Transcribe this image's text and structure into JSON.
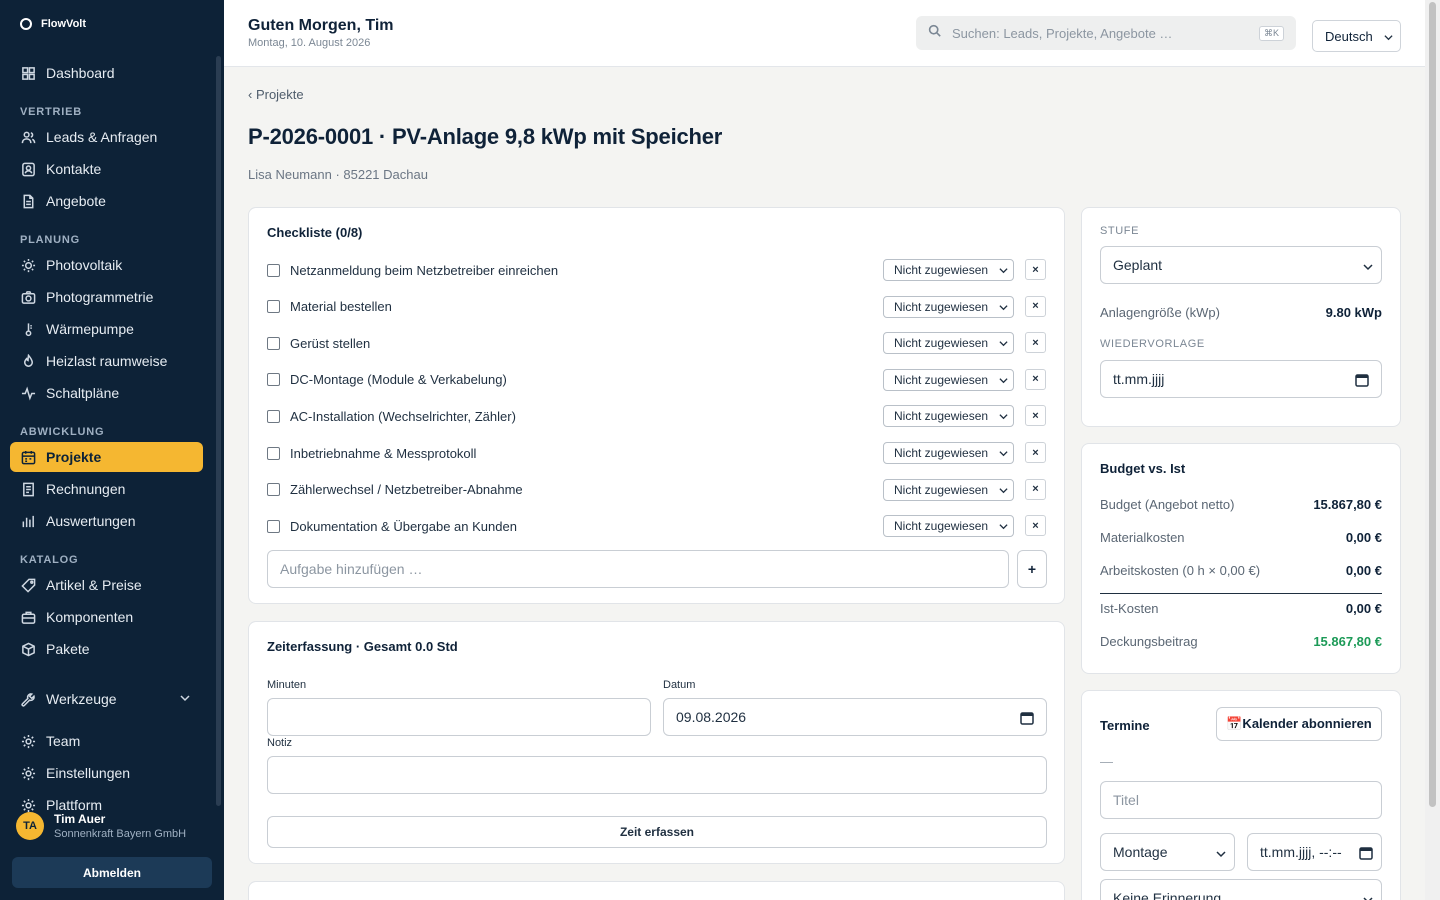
{
  "app": {
    "brand": "FlowVolt"
  },
  "sidebar": {
    "items_top": [
      {
        "label": "Dashboard",
        "icon": "grid-icon"
      }
    ],
    "sections": [
      {
        "title": "VERTRIEB",
        "items": [
          {
            "label": "Leads & Anfragen",
            "icon": "users-icon"
          },
          {
            "label": "Kontakte",
            "icon": "contact-icon"
          },
          {
            "label": "Angebote",
            "icon": "document-icon"
          }
        ]
      },
      {
        "title": "PLANUNG",
        "items": [
          {
            "label": "Photovoltaik",
            "icon": "sun-icon"
          },
          {
            "label": "Photogrammetrie",
            "icon": "camera-icon"
          },
          {
            "label": "Wärmepumpe",
            "icon": "thermometer-icon"
          },
          {
            "label": "Heizlast raumweise",
            "icon": "flame-icon"
          },
          {
            "label": "Schaltpläne",
            "icon": "pulse-icon"
          }
        ]
      },
      {
        "title": "ABWICKLUNG",
        "items": [
          {
            "label": "Projekte",
            "icon": "calendar-icon",
            "active": true
          },
          {
            "label": "Rechnungen",
            "icon": "receipt-icon"
          },
          {
            "label": "Auswertungen",
            "icon": "bar-chart-icon"
          }
        ]
      },
      {
        "title": "KATALOG",
        "items": [
          {
            "label": "Artikel & Preise",
            "icon": "tag-icon"
          },
          {
            "label": "Komponenten",
            "icon": "briefcase-icon"
          },
          {
            "label": "Pakete",
            "icon": "package-icon"
          }
        ]
      }
    ],
    "tools": {
      "label": "Werkzeuge",
      "icon": "wrench-icon"
    },
    "items_bottom": [
      {
        "label": "Team",
        "icon": "gear-icon"
      },
      {
        "label": "Einstellungen",
        "icon": "gear-icon"
      },
      {
        "label": "Plattform",
        "icon": "gear-icon"
      }
    ],
    "user": {
      "initials": "TA",
      "name": "Tim Auer",
      "company": "Sonnenkraft Bayern GmbH"
    },
    "logout_label": "Abmelden"
  },
  "header": {
    "greeting": "Guten Morgen, Tim",
    "date": "Montag, 10. August 2026",
    "search_placeholder": "Suchen: Leads, Projekte, Angebote …",
    "search_shortcut": "⌘K",
    "language": "Deutsch"
  },
  "page": {
    "breadcrumb": "‹ Projekte",
    "title": "P-2026-0001 · PV-Anlage 9,8 kWp mit Speicher",
    "subtitle": "Lisa Neumann · 85221 Dachau"
  },
  "checklist": {
    "title": "Checkliste (0/8)",
    "assign_default": "Nicht zugewiesen",
    "remove_label": "×",
    "items": [
      "Netzanmeldung beim Netzbetreiber einreichen",
      "Material bestellen",
      "Gerüst stellen",
      "DC-Montage (Module & Verkabelung)",
      "AC-Installation (Wechselrichter, Zähler)",
      "Inbetriebnahme & Messprotokoll",
      "Zählerwechsel / Netzbetreiber-Abnahme",
      "Dokumentation & Übergabe an Kunden"
    ],
    "add_placeholder": "Aufgabe hinzufügen …",
    "add_button": "+"
  },
  "time_tracking": {
    "title": "Zeiterfassung · Gesamt 0.0 Std",
    "minutes_label": "Minuten",
    "minutes_value": "",
    "date_label": "Datum",
    "date_value": "09.08.2026",
    "note_label": "Notiz",
    "note_value": "",
    "submit_label": "Zeit erfassen"
  },
  "status_card": {
    "stage_label": "STUFE",
    "stage_value": "Geplant",
    "size_label": "Anlagengröße (kWp)",
    "size_value": "9.80 kWp",
    "followup_label": "WIEDERVORLAGE",
    "followup_placeholder": "tt.mm.jjjj"
  },
  "budget": {
    "title": "Budget vs. Ist",
    "rows": [
      {
        "k": "Budget (Angebot netto)",
        "v": "15.867,80 €"
      },
      {
        "k": "Materialkosten",
        "v": "0,00 €"
      },
      {
        "k": "Arbeitskosten (0 h × 0,00 €)",
        "v": "0,00 €"
      },
      {
        "k": "Ist-Kosten",
        "v": "0,00 €"
      },
      {
        "k": "Deckungsbeitrag",
        "v": "15.867,80 €"
      }
    ],
    "positive_color": "#1c9a57"
  },
  "appointments": {
    "title": "Termine",
    "calendar_button": "📅Kalender abonnieren",
    "empty": "—",
    "title_placeholder": "Titel",
    "type_value": "Montage",
    "datetime_placeholder": "tt.mm.jjjj, --:--",
    "reminder_value": "Keine Erinnerung"
  },
  "colors": {
    "sidebar_bg": "#0d2237",
    "accent": "#f5b731"
  }
}
